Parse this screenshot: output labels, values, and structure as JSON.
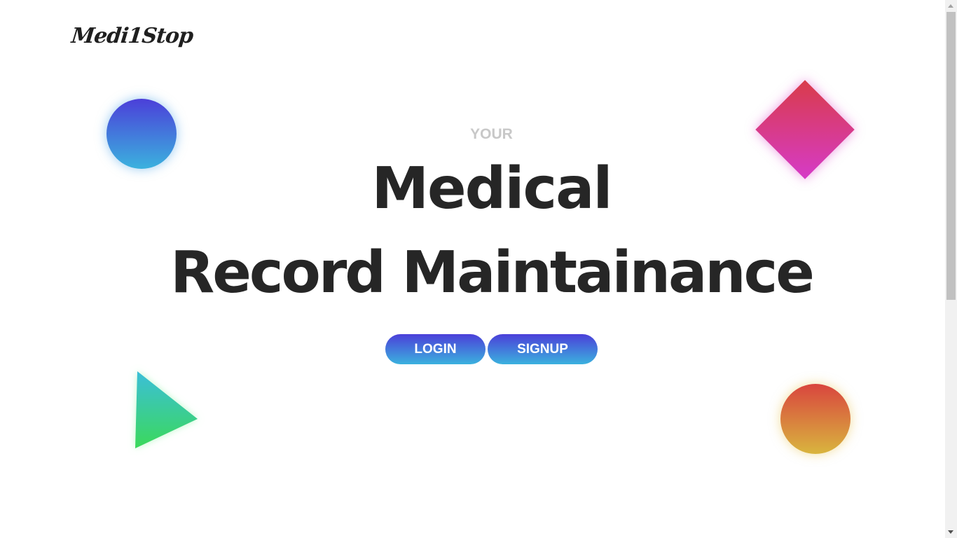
{
  "header": {
    "logo_text": "Medi1Stop"
  },
  "hero": {
    "eyebrow": "YOUR",
    "title_line1": "Medical",
    "title_line2": "Record Maintainance"
  },
  "actions": {
    "login_label": "LOGIN",
    "signup_label": "SIGNUP"
  },
  "decorations": [
    {
      "shape": "circle",
      "gradient": [
        "#4b3fd9",
        "#3bb2de"
      ]
    },
    {
      "shape": "diamond",
      "gradient": [
        "#d93b4a",
        "#d63bc8"
      ]
    },
    {
      "shape": "triangle",
      "gradient": [
        "#3bbfd9",
        "#3bd95a"
      ]
    },
    {
      "shape": "circle",
      "gradient": [
        "#d9453e",
        "#d9b53e"
      ]
    }
  ],
  "colors": {
    "button_gradient_top": "#4b3fd9",
    "button_gradient_bottom": "#3bb2de",
    "title_text": "#262626",
    "eyebrow_text": "#c8c8c8"
  }
}
